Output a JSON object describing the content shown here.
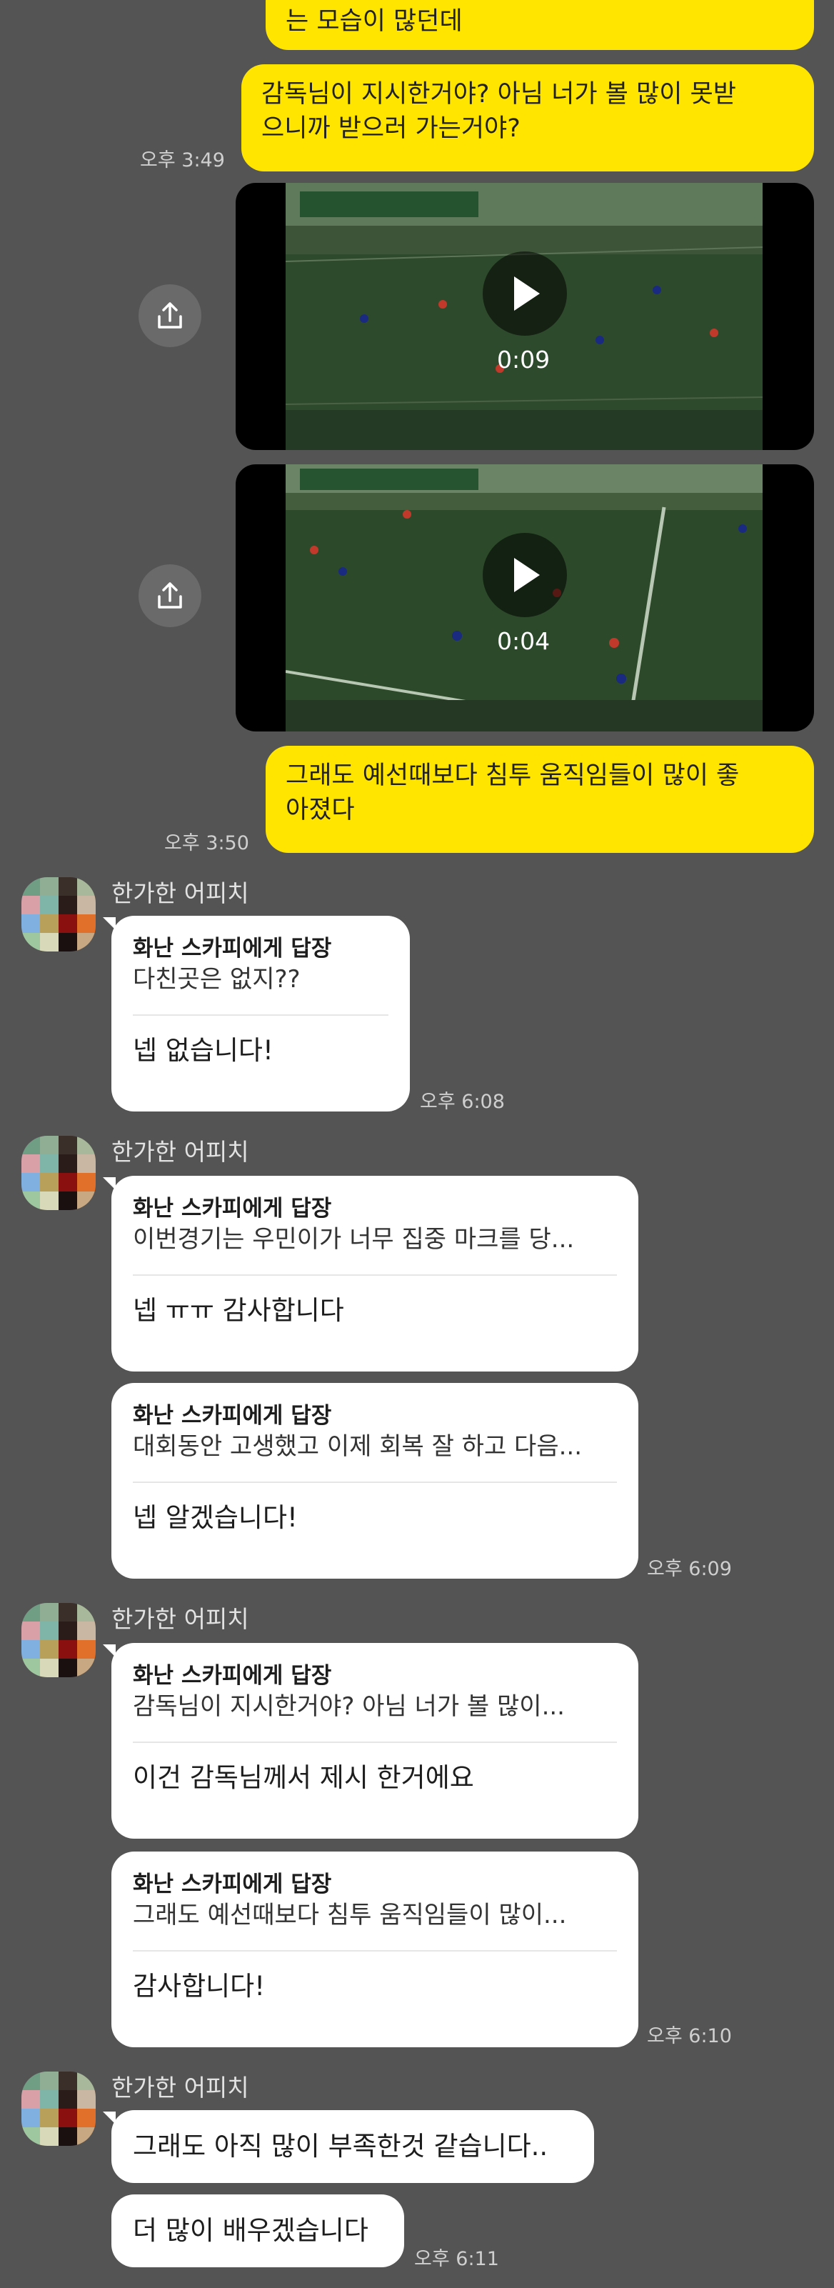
{
  "colors": {
    "background": "#545454",
    "my_bubble": "#FFE500",
    "their_bubble": "#FFFFFF"
  },
  "messages": {
    "top_partial": "는 모습이 많던데",
    "question": "감독님이 지시한거야? 아님 너가 볼 많이 못받\n으니까 받으러 가는거야?",
    "question_time": "오후 3:49",
    "video1_duration": "0:09",
    "video2_duration": "0:04",
    "praise": "그래도 예선때보다 침투 움직임들이 많이 좋\n아졌다",
    "praise_time": "오후 3:50"
  },
  "groups": [
    {
      "sender": "한가한 어피치",
      "replies": [
        {
          "head": "화난 스카피에게 답장",
          "quote": "다친곳은 없지??",
          "text": "넵 없습니다!"
        }
      ],
      "time": "오후 6:08"
    },
    {
      "sender": "한가한 어피치",
      "replies": [
        {
          "head": "화난 스카피에게 답장",
          "quote": "이번경기는 우민이가 너무 집중 마크를 당...",
          "text": "넵 ㅠㅠ 감사합니다"
        },
        {
          "head": "화난 스카피에게 답장",
          "quote": "대회동안 고생했고 이제 회복 잘 하고 다음...",
          "text": "넵 알겠습니다!"
        }
      ],
      "time": "오후 6:09"
    },
    {
      "sender": "한가한 어피치",
      "replies": [
        {
          "head": "화난 스카피에게 답장",
          "quote": "감독님이 지시한거야? 아님 너가 볼 많이...",
          "text": "이건 감독님께서 제시 한거에요"
        },
        {
          "head": "화난 스카피에게 답장",
          "quote": "그래도 예선때보다 침투 움직임들이 많이...",
          "text": "감사합니다!"
        }
      ],
      "time": "오후 6:10"
    },
    {
      "sender": "한가한 어피치",
      "plain": [
        "그래도 아직 많이 부족한것 같습니다..",
        "더 많이 배우겠습니다"
      ],
      "time": "오후 6:11"
    }
  ],
  "icons": {
    "share": "share-icon",
    "play": "play-icon",
    "avatar": "pixelated-avatar"
  }
}
